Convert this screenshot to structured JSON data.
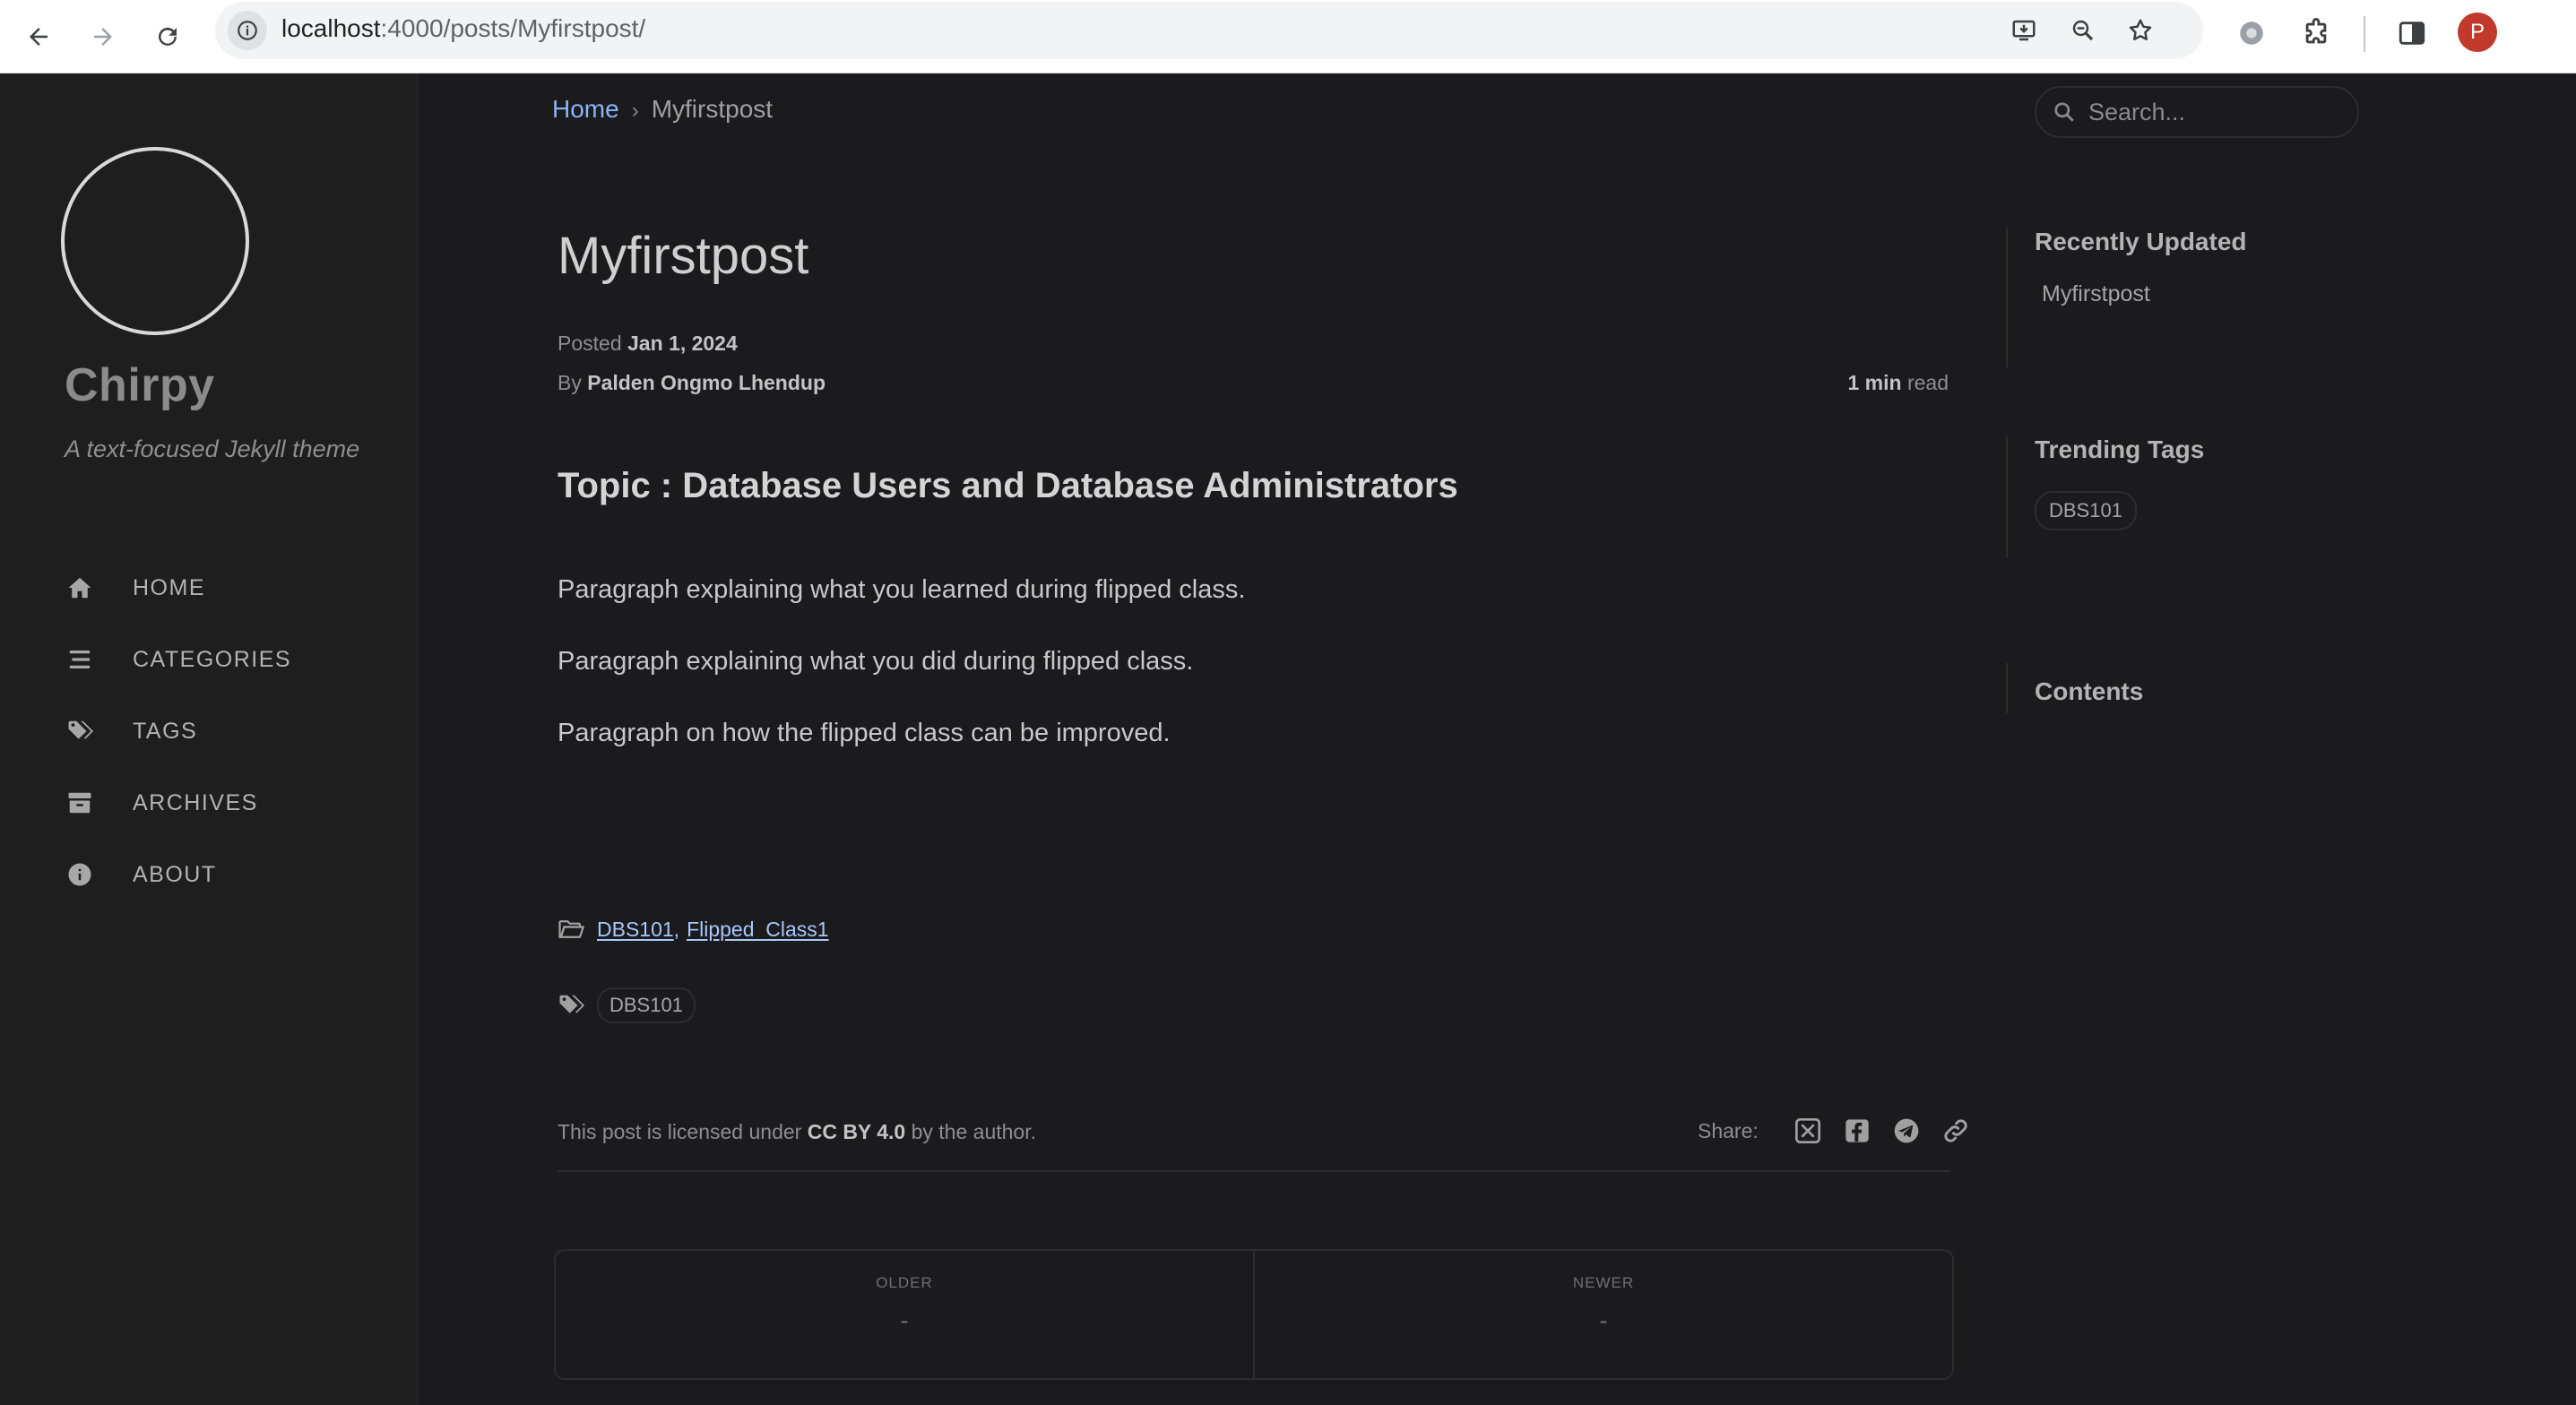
{
  "browser": {
    "url_host": "localhost",
    "url_path": ":4000/posts/Myfirstpost/",
    "profile_initial": "P"
  },
  "sidebar": {
    "site_title": "Chirpy",
    "site_subtitle": "A text-focused Jekyll theme",
    "nav": [
      {
        "label": "HOME",
        "icon": "home-icon"
      },
      {
        "label": "CATEGORIES",
        "icon": "stream-icon"
      },
      {
        "label": "TAGS",
        "icon": "tags-icon"
      },
      {
        "label": "ARCHIVES",
        "icon": "archive-icon"
      },
      {
        "label": "ABOUT",
        "icon": "info-circle-icon"
      }
    ]
  },
  "topbar": {
    "breadcrumb_home": "Home",
    "breadcrumb_sep": "›",
    "breadcrumb_current": "Myfirstpost",
    "search_placeholder": "Search..."
  },
  "post": {
    "title": "Myfirstpost",
    "posted_label": "Posted",
    "posted_date": "Jan 1, 2024",
    "by_label": "By",
    "author": "Palden Ongmo Lhendup",
    "read_time_value": "1 min",
    "read_time_label": "read",
    "heading": "Topic : Database Users and Database Administrators",
    "paragraphs": [
      "Paragraph explaining what you learned during flipped class.",
      "Paragraph explaining what you did during flipped class.",
      "Paragraph on how the flipped class can be improved."
    ],
    "categories": [
      "DBS101",
      "Flipped_Class1"
    ],
    "category_sep": ",",
    "tags": [
      "DBS101"
    ],
    "license_prefix": "This post is licensed under",
    "license_name": "CC BY 4.0",
    "license_suffix": "by the author.",
    "share_label": "Share:",
    "share_icons": [
      "x-twitter-icon",
      "facebook-icon",
      "telegram-icon",
      "link-icon"
    ],
    "older_caption": "OLDER",
    "older_value": "-",
    "newer_caption": "NEWER",
    "newer_value": "-"
  },
  "panel": {
    "recent_title": "Recently Updated",
    "recent_items": [
      "Myfirstpost"
    ],
    "trending_title": "Trending Tags",
    "trending_tags": [
      "DBS101"
    ],
    "toc_title": "Contents"
  },
  "colors": {
    "page_bg": "#1b1b1e",
    "sidebar_bg": "#1e1e1e",
    "link": "#8ab4f8",
    "text": "#c8c8c8"
  }
}
